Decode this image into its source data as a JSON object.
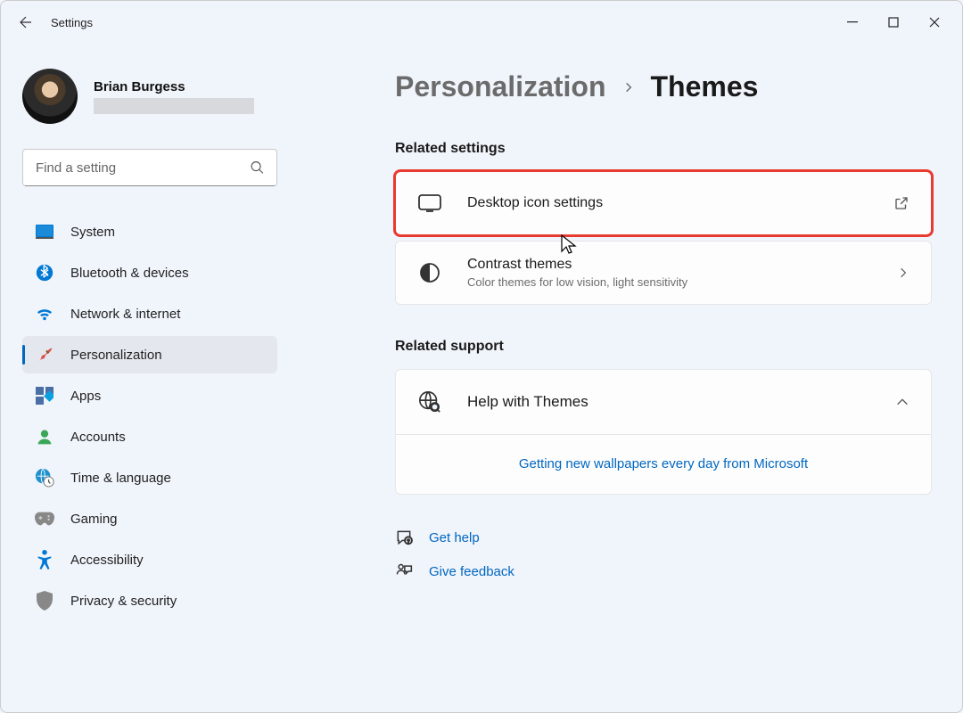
{
  "app": {
    "title": "Settings"
  },
  "profile": {
    "name": "Brian Burgess"
  },
  "search": {
    "placeholder": "Find a setting"
  },
  "nav": {
    "system": "System",
    "bluetooth": "Bluetooth & devices",
    "network": "Network & internet",
    "personalization": "Personalization",
    "apps": "Apps",
    "accounts": "Accounts",
    "time": "Time & language",
    "gaming": "Gaming",
    "accessibility": "Accessibility",
    "privacy": "Privacy & security"
  },
  "breadcrumb": {
    "parent": "Personalization",
    "current": "Themes"
  },
  "sections": {
    "related_settings": "Related settings",
    "related_support": "Related support"
  },
  "cards": {
    "desktop_icons": {
      "title": "Desktop icon settings"
    },
    "contrast": {
      "title": "Contrast themes",
      "sub": "Color themes for low vision, light sensitivity"
    }
  },
  "support": {
    "title": "Help with Themes",
    "link": "Getting new wallpapers every day from Microsoft"
  },
  "help": {
    "get_help": "Get help",
    "feedback": "Give feedback"
  }
}
